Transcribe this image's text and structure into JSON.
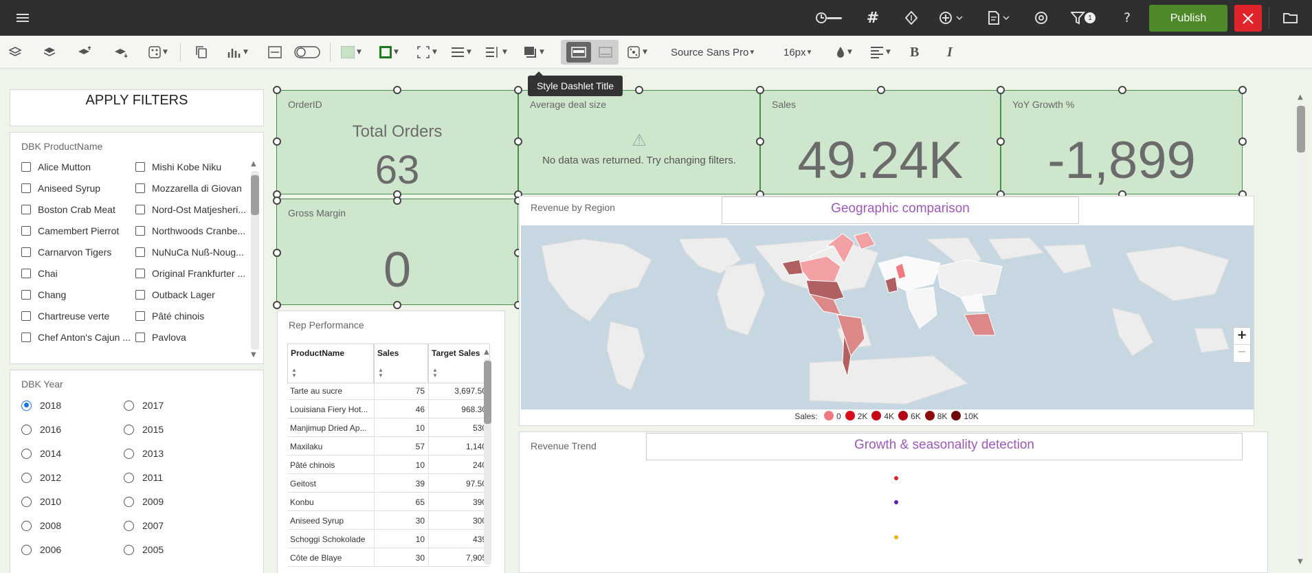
{
  "topbar": {
    "publish_label": "Publish",
    "filter_count": "1",
    "icons": [
      "menu-icon",
      "timer-slider-icon",
      "grid-hash-icon",
      "diamond-icon",
      "add-circle-icon",
      "page-icon",
      "refresh-cog-icon",
      "filter-icon",
      "help-icon",
      "close-icon",
      "folder-open-icon"
    ]
  },
  "toolbar": {
    "font_family": "Source Sans Pro",
    "font_size": "16px",
    "tooltip": "Style Dashlet Title",
    "bold_label": "B",
    "italic_label": "I"
  },
  "filters": {
    "apply_label": "APPLY FILTERS",
    "product_title": "DBK ProductName",
    "products_col1": [
      "Alice Mutton",
      "Aniseed Syrup",
      "Boston Crab Meat",
      "Camembert Pierrot",
      "Carnarvon Tigers",
      "Chai",
      "Chang",
      "Chartreuse verte",
      "Chef Anton's Cajun ..."
    ],
    "products_col2": [
      "Mishi Kobe Niku",
      "Mozzarella di Giovan",
      "Nord-Ost Matjesheri...",
      "Northwoods Cranbe...",
      "NuNuCa Nuß-Noug...",
      "Original Frankfurter ...",
      "Outback Lager",
      "Pâté chinois",
      "Pavlova"
    ],
    "year_title": "DBK Year",
    "years_col1": [
      "2018",
      "2016",
      "2014",
      "2012",
      "2010",
      "2008",
      "2006"
    ],
    "years_col2": [
      "2017",
      "2015",
      "2013",
      "2011",
      "2009",
      "2007",
      "2005"
    ],
    "selected_year": "2018"
  },
  "kpis": {
    "orders": {
      "title": "OrderID",
      "label": "Total Orders",
      "value": "63"
    },
    "deal": {
      "title": "Average deal size",
      "warning_icon": "⚠",
      "message": "No data was returned. Try changing filters."
    },
    "sales": {
      "title": "Sales",
      "value": "49.24K"
    },
    "yoy": {
      "title": "YoY Growth %",
      "value": "-1,899"
    },
    "margin": {
      "title": "Gross Margin",
      "value": "0"
    }
  },
  "region": {
    "title": "Revenue by Region",
    "subtitle": "Geographic comparison",
    "zoom_in": "+",
    "zoom_out": "−",
    "legend_label": "Sales:",
    "legend": [
      {
        "label": "0",
        "color": "#f07a80"
      },
      {
        "label": "2K",
        "color": "#d8101b"
      },
      {
        "label": "4K",
        "color": "#c40a16"
      },
      {
        "label": "6K",
        "color": "#b00812"
      },
      {
        "label": "8K",
        "color": "#8a0a0e"
      },
      {
        "label": "10K",
        "color": "#6e0a0a"
      }
    ]
  },
  "rep": {
    "title": "Rep Performance",
    "columns": [
      "ProductName",
      "Sales",
      "Target Sales"
    ],
    "rows": [
      [
        "Tarte au sucre",
        "75",
        "3,697.50"
      ],
      [
        "Louisiana Fiery Hot...",
        "46",
        "968.30"
      ],
      [
        "Manjimup Dried Ap...",
        "10",
        "530"
      ],
      [
        "Maxilaku",
        "57",
        "1,140"
      ],
      [
        "Pâté chinois",
        "10",
        "240"
      ],
      [
        "Geitost",
        "39",
        "97.50"
      ],
      [
        "Konbu",
        "65",
        "390"
      ],
      [
        "Aniseed Syrup",
        "30",
        "300"
      ],
      [
        "Schoggi Schokolade",
        "10",
        "439"
      ],
      [
        "Côte de Blaye",
        "30",
        "7,905"
      ]
    ]
  },
  "trend": {
    "title": "Revenue Trend",
    "subtitle": "Growth & seasonality detection",
    "dot_colors": [
      "#e02020",
      "#5a1fb0",
      "#e8b400"
    ]
  }
}
